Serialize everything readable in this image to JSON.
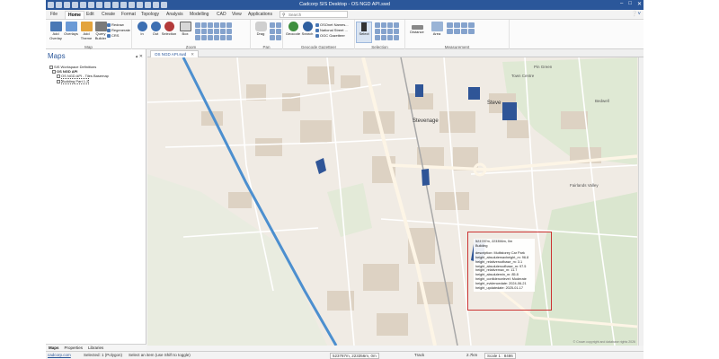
{
  "window": {
    "title": "Cadcorp SIS Desktop - OS NGD API.swd",
    "controls": [
      "–",
      "□",
      "✕"
    ]
  },
  "menu": {
    "tabs": [
      "File",
      "Home",
      "Edit",
      "Create",
      "Format",
      "Topology",
      "Analysis",
      "Modelling",
      "CAD",
      "View",
      "Applications"
    ],
    "active": "Home",
    "search_placeholder": "Search"
  },
  "ribbon": {
    "groups": [
      {
        "label": "Map",
        "buttons": [
          "Add Overlay",
          "Overlays",
          "Add Theme",
          "Query Builder"
        ],
        "small": [
          "Redraw",
          "Regenerate",
          "CRS"
        ]
      },
      {
        "label": "Zoom",
        "buttons": [
          "In",
          "Out",
          "Selection",
          "Box"
        ]
      },
      {
        "label": "Pan",
        "buttons": [
          "Drag"
        ]
      },
      {
        "label": "Geocode Gazetteer",
        "buttons": [
          "Geocode",
          "Search"
        ],
        "small": [
          "OSOnet Names...",
          "National Street ...",
          "OGC Gazetteer"
        ]
      },
      {
        "label": "Selection",
        "buttons": [
          "Select"
        ]
      },
      {
        "label": "Measurement",
        "buttons": [
          "Distance",
          "Area"
        ]
      }
    ]
  },
  "panel": {
    "title": "Maps",
    "tree": [
      "SIS Workspace Definitions",
      "OS NGD API",
      "OS NGD API - Tiles Basemap",
      "Building Part 1.2"
    ],
    "tabs": [
      "Maps",
      "Properties",
      "Libraries"
    ]
  },
  "document": {
    "tab": "OS NGD API.swd"
  },
  "map": {
    "labels": [
      "Stevenage",
      "Steve",
      "Bedwell",
      "Pin Green",
      "Town Centre",
      "Fairlands Valley"
    ],
    "popup": {
      "lines": [
        "523787m, 223356m, 0m",
        "Building",
        "",
        "description: Multistorey Car Park",
        "height_absolutemaxheight_m: 96.8",
        "height_relativeroofbase_m: 3.1",
        "height_absoluteroofbase_m: 97.5",
        "height_relativemax_m: 11.7",
        "height_absolutemin_m: 85.8",
        "height_confidencelevel: Moderate",
        "height_evidencedate: 2024-06-21",
        "height_updatedate: 2025-01-17"
      ]
    },
    "attribution": "© Crown copyright and database rights 2026"
  },
  "status": {
    "site": "cadcorp.com",
    "selection": "Selected: 1 (Polygon)",
    "hint": "Select an item (use Shift to toggle)",
    "coords": "523787m, 223356m, 0m",
    "track": "Track",
    "distance": "2.7km",
    "scale": "Scale 1 : 8486"
  },
  "colors": {
    "titlebar": "#2b579a",
    "accent": "#2b579a",
    "building_selected": "#2f5597",
    "highlight": "#cc3333",
    "railway": "#4c8fcf"
  }
}
